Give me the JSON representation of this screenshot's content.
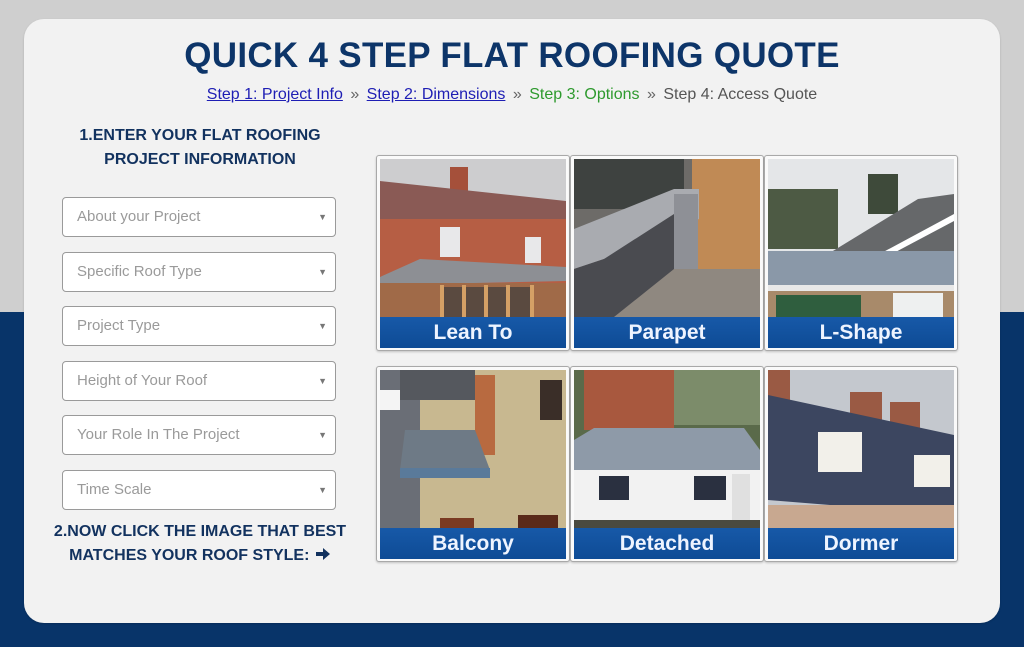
{
  "header": {
    "title": "QUICK 4 STEP FLAT ROOFING QUOTE",
    "steps": [
      {
        "label": "Step 1: Project Info",
        "state": "link"
      },
      {
        "label": "Step 2: Dimensions",
        "state": "link"
      },
      {
        "label": "Step 3: Options",
        "state": "current"
      },
      {
        "label": "Step 4: Access Quote",
        "state": "pending"
      }
    ],
    "separator": "»"
  },
  "form": {
    "heading1": "1.ENTER YOUR FLAT ROOFING PROJECT INFORMATION",
    "selects": [
      {
        "placeholder": "About your Project",
        "value": ""
      },
      {
        "placeholder": "Specific Roof Type",
        "value": ""
      },
      {
        "placeholder": "Project Type",
        "value": ""
      },
      {
        "placeholder": "Height of Your Roof",
        "value": ""
      },
      {
        "placeholder": "Your Role In The Project",
        "value": ""
      },
      {
        "placeholder": "Time Scale",
        "value": ""
      }
    ],
    "caret": "▼",
    "heading2": "2.NOW CLICK THE IMAGE THAT BEST MATCHES YOUR ROOF STYLE:",
    "heading2_icon": "arrow-right-icon"
  },
  "roof_styles": [
    {
      "label": "Lean To"
    },
    {
      "label": "Parapet"
    },
    {
      "label": "L-Shape"
    },
    {
      "label": "Balcony"
    },
    {
      "label": "Detached"
    },
    {
      "label": "Dormer"
    }
  ],
  "colors": {
    "brand_navy": "#0d3569",
    "link_blue": "#1e1eb4",
    "current_step_green": "#2e9a2e",
    "label_bar_blue": "#1759a8",
    "background_top": "#cfcfcf",
    "background_bottom": "#083469"
  }
}
